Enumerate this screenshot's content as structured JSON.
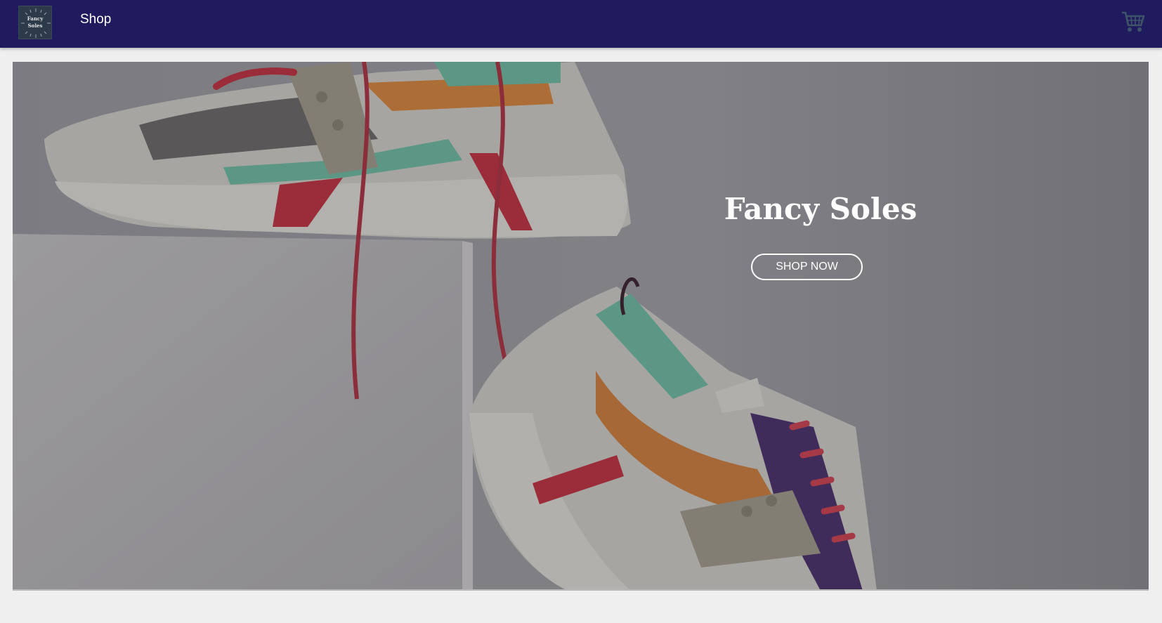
{
  "brand": {
    "logo_line1": "Fancy",
    "logo_line2": "Soles"
  },
  "nav": {
    "shop_label": "Shop",
    "cart_icon": "cart-icon"
  },
  "hero": {
    "title": "Fancy Soles",
    "cta_label": "SHOP NOW",
    "image_subject": "two colorful sneakers on a white box"
  },
  "colors": {
    "navbar": "#1f1b5e",
    "cart_icon": "#3f5468",
    "page_background": "#efefef",
    "cta_border": "#ffffff"
  }
}
